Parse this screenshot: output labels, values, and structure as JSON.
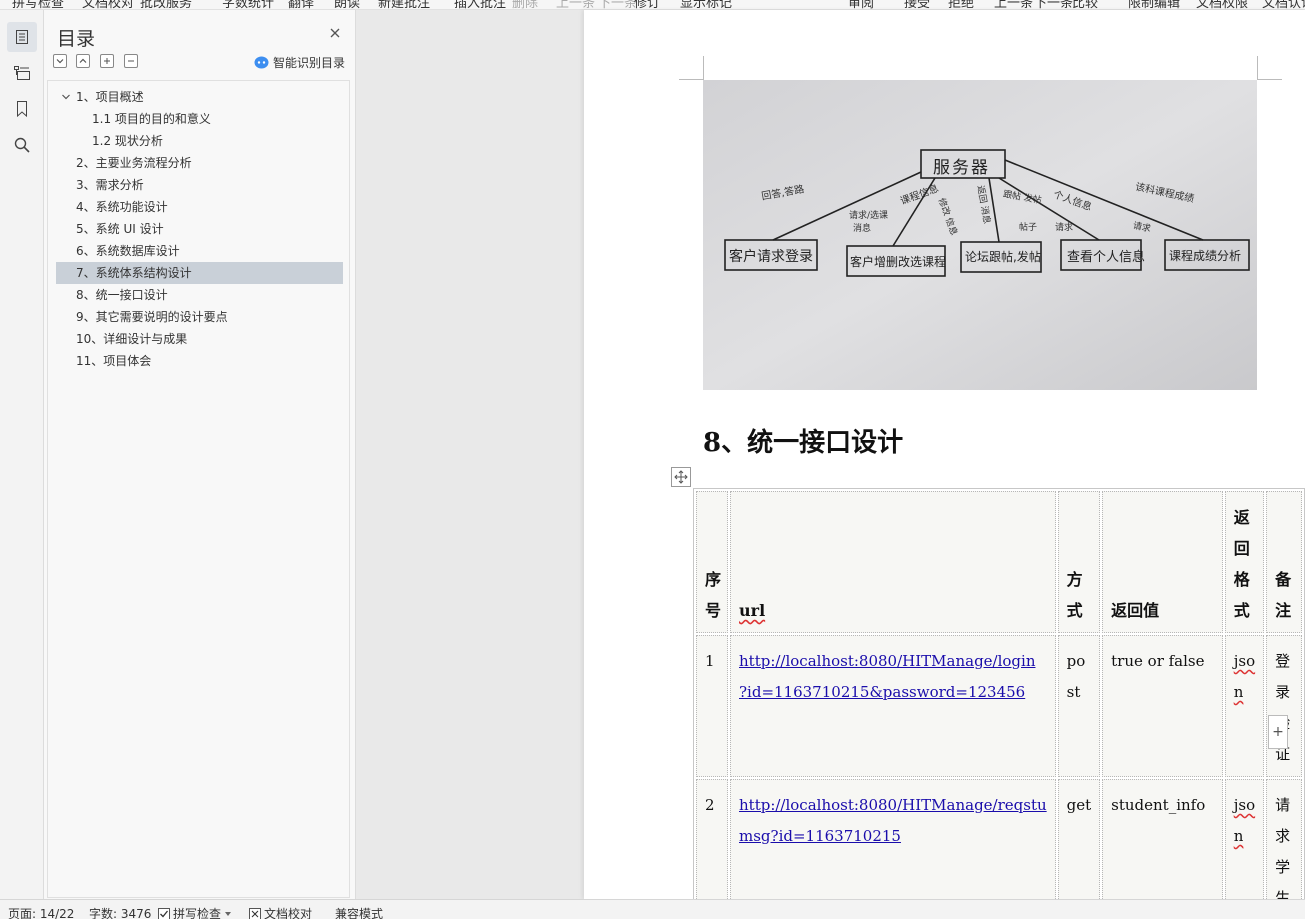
{
  "ribbon": {
    "items": [
      "拼写检查",
      "文档校对",
      "批改服务",
      "字数统计",
      "翻译",
      "朗读",
      "新建批注",
      "插入批注",
      "删除",
      "上一条",
      "下一条",
      "修订",
      "显示标记",
      "审阅",
      "接受",
      "拒绝",
      "上一条",
      "下一条",
      "比较",
      "限制编辑",
      "文档权限",
      "文档认证"
    ]
  },
  "rail": {
    "icons": [
      "toc-icon",
      "outline-icon",
      "bookmark-icon",
      "search-icon"
    ]
  },
  "toc": {
    "title": "目录",
    "smart_label": "智能识别目录",
    "items": [
      {
        "label": "1、项目概述",
        "level": 1,
        "expanded": true
      },
      {
        "label": "1.1  项目的目的和意义",
        "level": 2
      },
      {
        "label": "1.2  现状分析",
        "level": 2
      },
      {
        "label": "2、主要业务流程分析",
        "level": 1
      },
      {
        "label": "3、需求分析",
        "level": 1
      },
      {
        "label": "4、系统功能设计",
        "level": 1
      },
      {
        "label": "5、系统 UI 设计",
        "level": 1
      },
      {
        "label": "6、系统数据库设计",
        "level": 1
      },
      {
        "label": "7、系统体系结构设计",
        "level": 1,
        "selected": true
      },
      {
        "label": "8、统一接口设计",
        "level": 1
      },
      {
        "label": "9、其它需要说明的设计要点",
        "level": 1
      },
      {
        "label": "10、详细设计与成果",
        "level": 1
      },
      {
        "label": "11、项目体会",
        "level": 1
      }
    ]
  },
  "document": {
    "photo": {
      "server": "服务器",
      "clients": [
        "客户请求登录",
        "客户增删改选课程",
        "论坛跟帖,发帖",
        "查看个人信息",
        "课程成绩分析"
      ],
      "arrows": [
        "回答,答路",
        "课程信息",
        "请求/选课",
        "消息",
        "修改 信息",
        "返回 消息",
        "跟帖 发帖",
        "帖子",
        "个人信息",
        "请求",
        "该科课程成绩",
        "请求"
      ]
    },
    "heading": "8、统一接口设计",
    "table": {
      "headers": [
        "序号",
        "url",
        "方式",
        "返回值",
        "返回格式",
        "备注"
      ],
      "rows": [
        {
          "no": "1",
          "url_line1": "http://localhost:8080/HITManage/login",
          "url_line2": "?id=1163710215&password=123456",
          "method_line1": "po",
          "method_line2": "st",
          "return": "true or false",
          "format_line1": "jso",
          "format_line2": "n",
          "note": "登录验证"
        },
        {
          "no": "2",
          "url_line1": "http://localhost:8080/HITManage/reqstu",
          "url_line2": "msg?id=1163710215",
          "method_line1": "get",
          "method_line2": "",
          "return": "student_info",
          "format_line1": "jso",
          "format_line2": "n",
          "note": "请求学生"
        }
      ]
    }
  },
  "status": {
    "page": "页面: 14/22",
    "words": "字数: 3476",
    "spell": "拼写检查",
    "proof": "文档校对",
    "compat": "兼容模式"
  }
}
